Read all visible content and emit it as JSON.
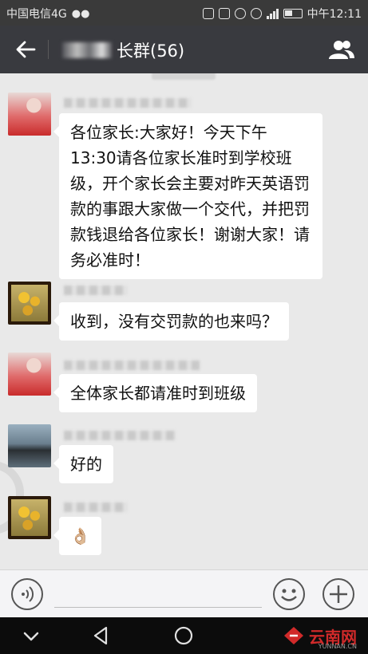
{
  "status_bar": {
    "carrier": "中国电信4G",
    "time": "中午12:11"
  },
  "header": {
    "title": "长群(56)"
  },
  "messages": [
    {
      "text": "各位家长:大家好！今天下午13:30请各位家长准时到学校班级，开个家长会主要对昨天英语罚款的事跟大家做一个交代，并把罚款钱退给各位家长！谢谢大家！请务必准时！"
    },
    {
      "text": "收到，没有交罚款的也来吗？"
    },
    {
      "text": "全体家长都请准时到班级"
    },
    {
      "text": "好的"
    },
    {
      "text": "👌🏼"
    }
  ],
  "watermark": {
    "logo_text": "云南网",
    "url": "YUNNAN.CN"
  },
  "colors": {
    "header_bg": "#393a3f",
    "chat_bg": "#e9e9e9",
    "bubble_bg": "#ffffff",
    "watermark": "#d12a2a"
  }
}
